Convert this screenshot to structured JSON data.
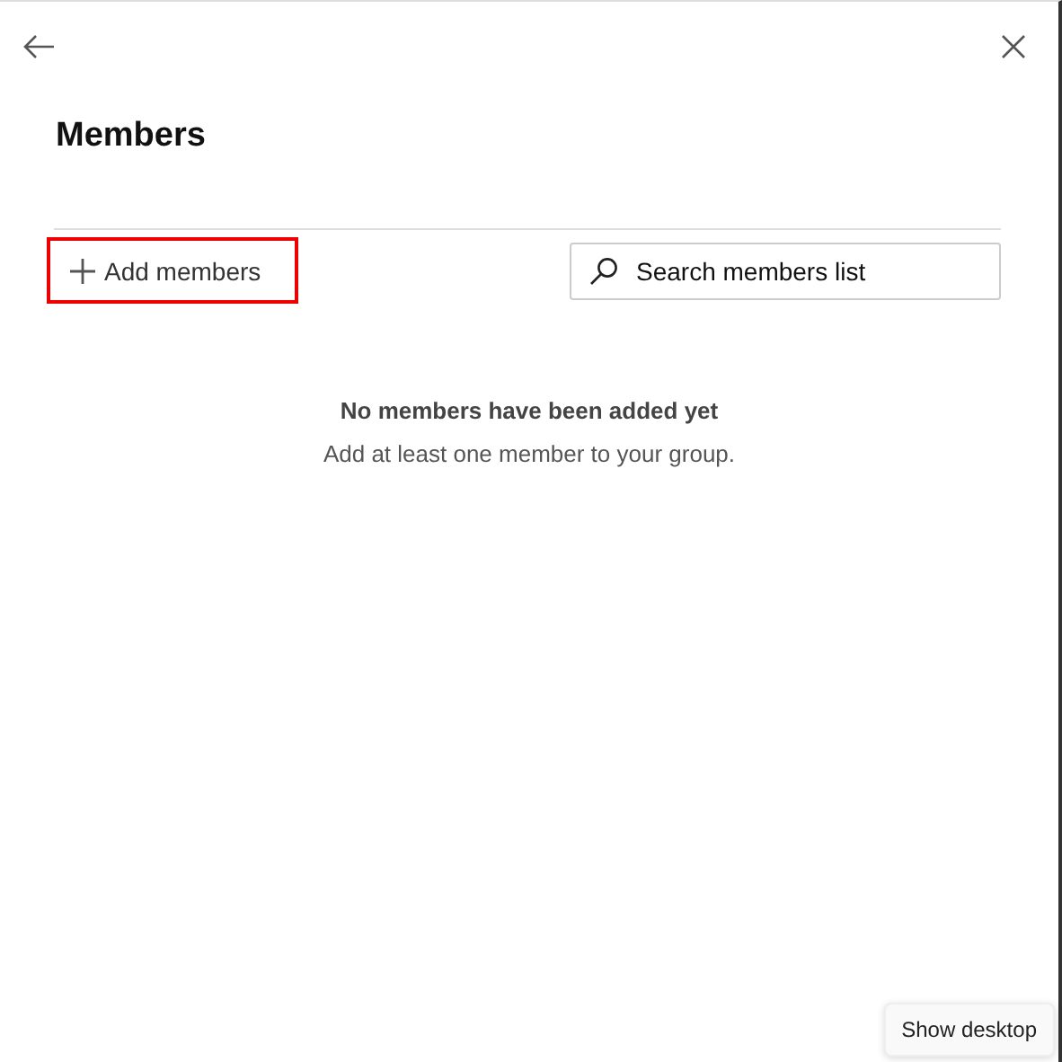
{
  "panel": {
    "title": "Members"
  },
  "add_button": {
    "label": "Add members",
    "highlighted": true
  },
  "search": {
    "placeholder": "Search members list"
  },
  "empty_state": {
    "heading": "No members have been added yet",
    "message": "Add at least one member to your group."
  },
  "tooltip": {
    "label": "Show desktop"
  }
}
